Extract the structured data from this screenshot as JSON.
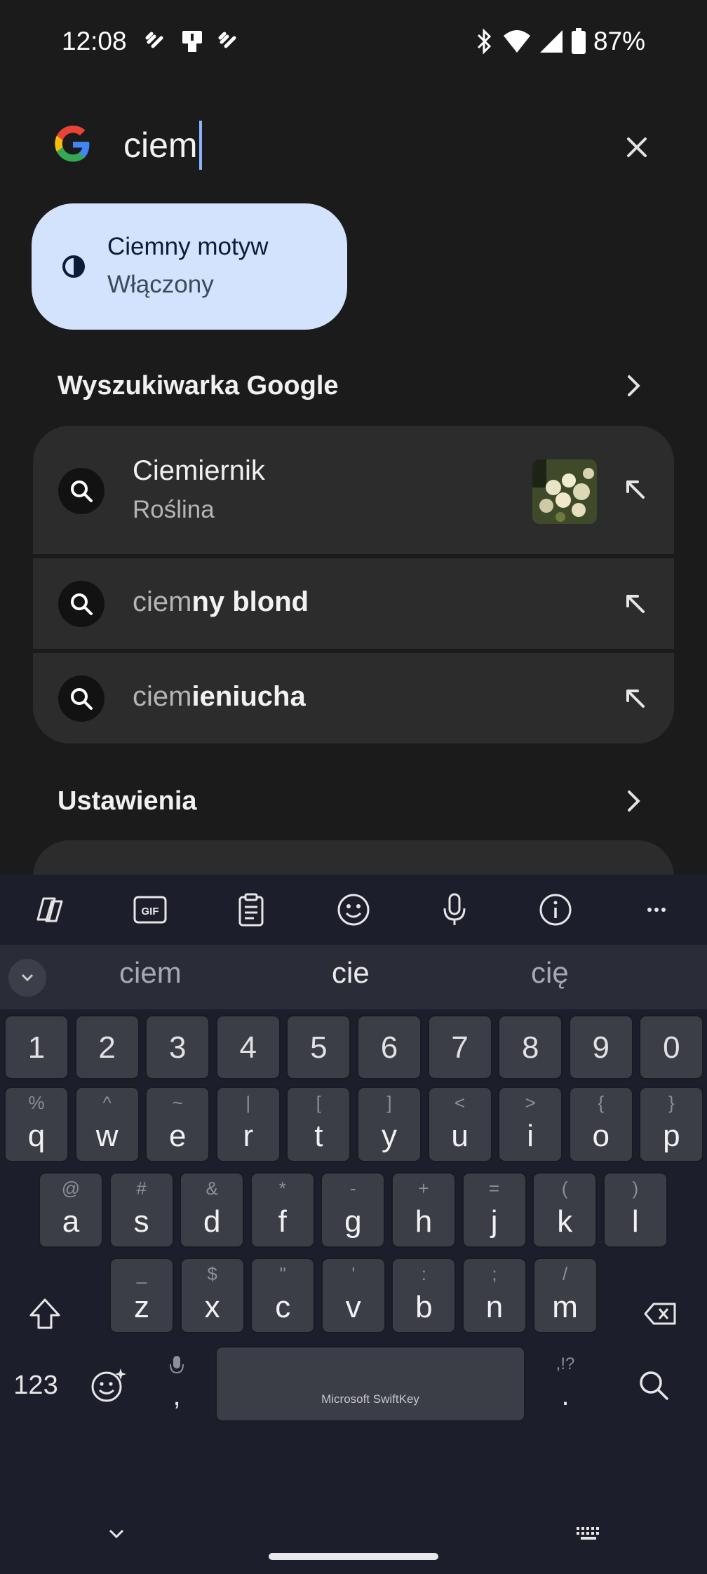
{
  "status_bar": {
    "time": "12:08",
    "battery": "87%"
  },
  "search": {
    "query": "ciem"
  },
  "quick_setting": {
    "title": "Ciemny motyw",
    "state": "Włączony"
  },
  "sections": {
    "google": "Wyszukiwarka Google",
    "settings": "Ustawienia"
  },
  "suggestions": [
    {
      "typed": "ciem",
      "rest": "iernik",
      "full": "Ciemiernik",
      "subtitle": "Roślina"
    },
    {
      "typed": "ciem",
      "rest": "ny blond"
    },
    {
      "typed": "ciem",
      "rest": "ieniucha"
    }
  ],
  "keyboard": {
    "word_suggestions": [
      "ciem",
      "cie",
      "cię"
    ],
    "numbers": [
      "1",
      "2",
      "3",
      "4",
      "5",
      "6",
      "7",
      "8",
      "9",
      "0"
    ],
    "row1": [
      {
        "k": "q",
        "h": "%"
      },
      {
        "k": "w",
        "h": "^"
      },
      {
        "k": "e",
        "h": "~"
      },
      {
        "k": "r",
        "h": "|"
      },
      {
        "k": "t",
        "h": "["
      },
      {
        "k": "y",
        "h": "]"
      },
      {
        "k": "u",
        "h": "<"
      },
      {
        "k": "i",
        "h": ">"
      },
      {
        "k": "o",
        "h": "{"
      },
      {
        "k": "p",
        "h": "}"
      }
    ],
    "row2": [
      {
        "k": "a",
        "h": "@"
      },
      {
        "k": "s",
        "h": "#"
      },
      {
        "k": "d",
        "h": "&"
      },
      {
        "k": "f",
        "h": "*"
      },
      {
        "k": "g",
        "h": "-"
      },
      {
        "k": "h",
        "h": "+"
      },
      {
        "k": "j",
        "h": "="
      },
      {
        "k": "k",
        "h": "("
      },
      {
        "k": "l",
        "h": ")"
      }
    ],
    "row3": [
      {
        "k": "z",
        "h": "_"
      },
      {
        "k": "x",
        "h": "$"
      },
      {
        "k": "c",
        "h": "\""
      },
      {
        "k": "v",
        "h": "'"
      },
      {
        "k": "b",
        "h": ":"
      },
      {
        "k": "n",
        "h": ";"
      },
      {
        "k": "m",
        "h": "/"
      }
    ],
    "num_switch": "123",
    "comma": ",",
    "period": ".",
    "period_hint": ",!?",
    "space_label": "Microsoft SwiftKey",
    "toolbar_gif": "GIF"
  },
  "colors": {
    "accent_chip": "#d3e3fd",
    "cursor": "#8ab4f8",
    "card": "#2c2c2c",
    "keyboard_bg": "#1c1f2b"
  }
}
